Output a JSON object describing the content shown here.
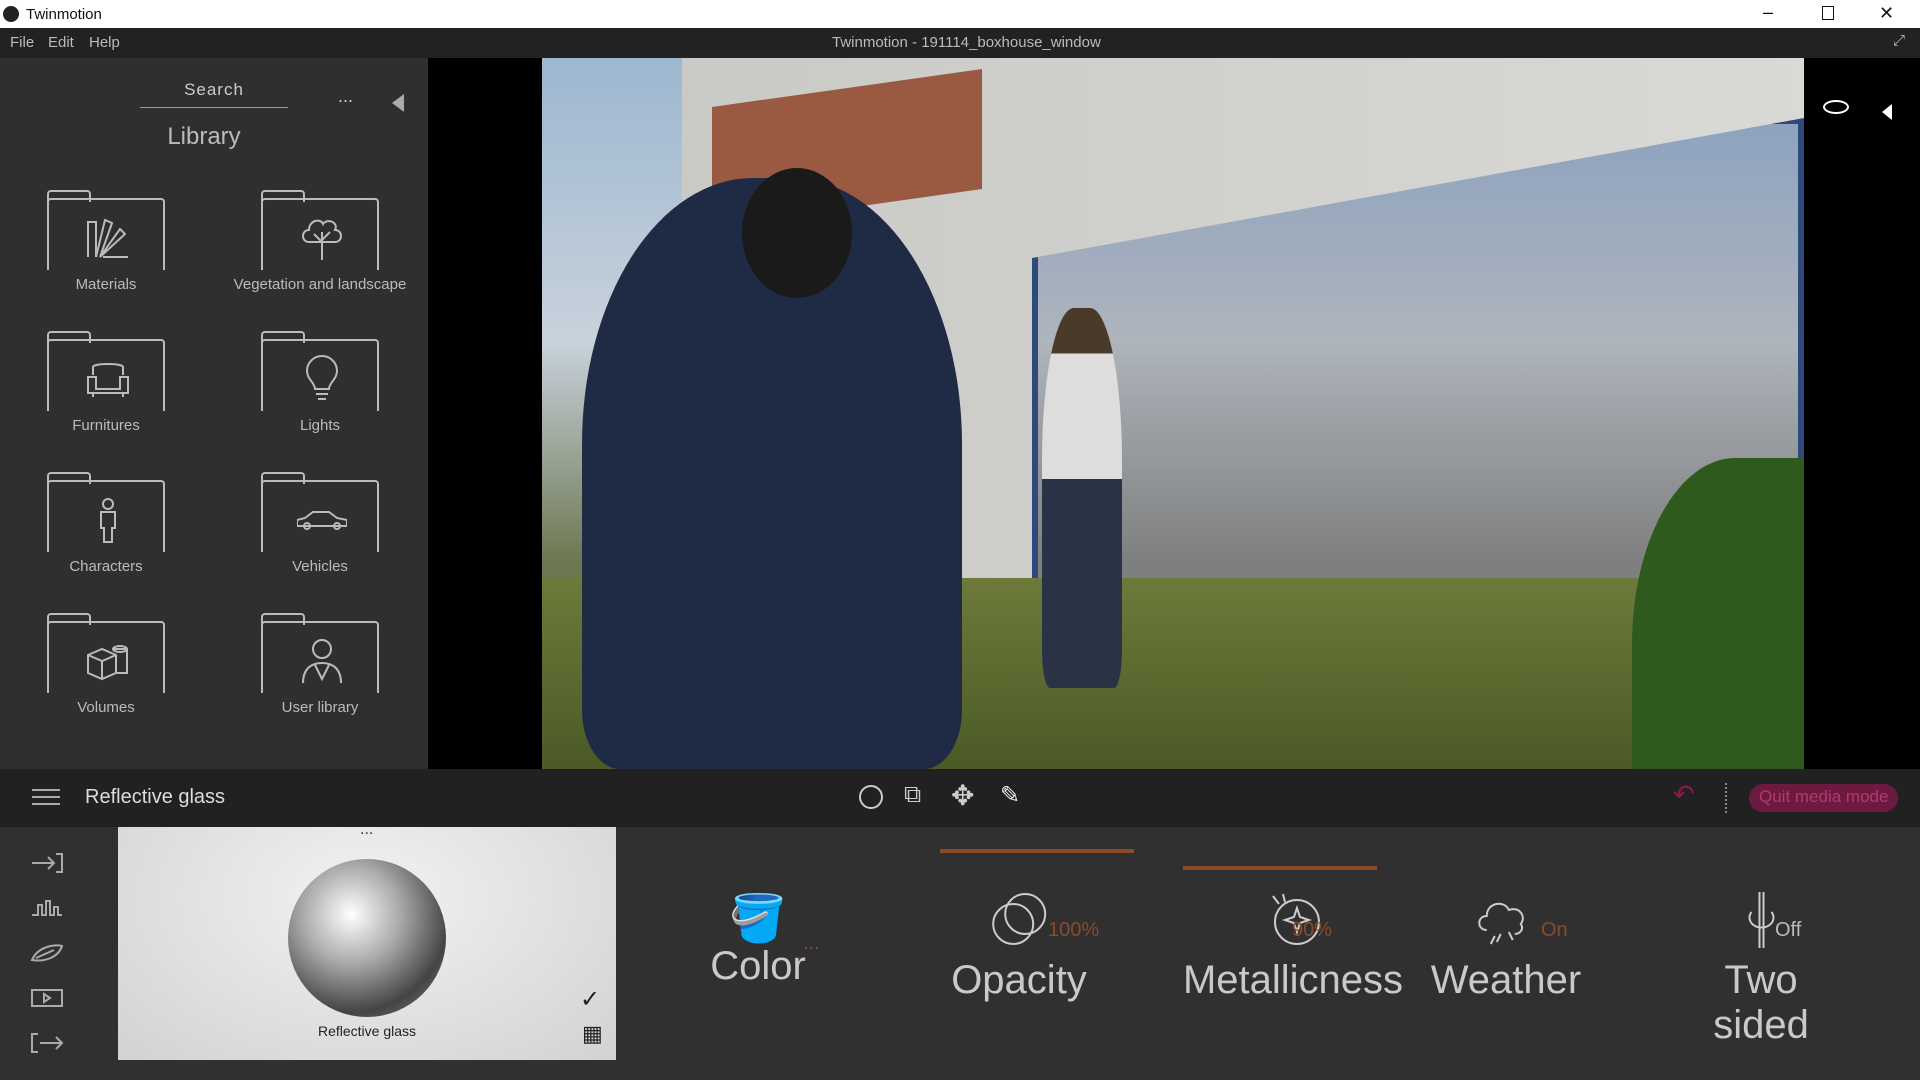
{
  "app": {
    "title": "Twinmotion",
    "window_title": "Twinmotion - 191114_boxhouse_window"
  },
  "menu": [
    "File",
    "Edit",
    "Help"
  ],
  "library": {
    "search_label": "Search",
    "more": "...",
    "title": "Library",
    "items": [
      {
        "label": "Materials",
        "icon": "materials-icon"
      },
      {
        "label": "Vegetation and landscape",
        "icon": "tree-icon"
      },
      {
        "label": "Furnitures",
        "icon": "armchair-icon"
      },
      {
        "label": "Lights",
        "icon": "lightbulb-icon"
      },
      {
        "label": "Characters",
        "icon": "person-icon"
      },
      {
        "label": "Vehicles",
        "icon": "car-icon"
      },
      {
        "label": "Volumes",
        "icon": "cubes-icon"
      },
      {
        "label": "User library",
        "icon": "user-icon"
      }
    ]
  },
  "toolbar": {
    "selected_name": "Reflective glass",
    "quit_label": "Quit media mode",
    "accent": "#8b1a4a"
  },
  "material": {
    "preview_label": "Reflective glass",
    "more": "..."
  },
  "properties": [
    {
      "label": "Color",
      "value": "...",
      "icon": "paint-bucket-icon"
    },
    {
      "label": "Opacity",
      "value": "100%",
      "icon": "opacity-icon"
    },
    {
      "label": "Metallicness",
      "value": "90%",
      "icon": "metal-icon"
    },
    {
      "label": "Weather",
      "value": "On",
      "icon": "weather-icon"
    },
    {
      "label": "Two sided",
      "value": "Off",
      "icon": "two-sided-icon"
    }
  ],
  "colors": {
    "orange": "#8a4a2a",
    "panel": "#2f2f2f"
  }
}
